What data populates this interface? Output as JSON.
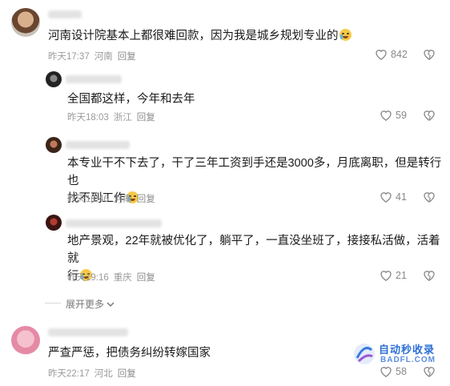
{
  "comments": [
    {
      "text": "河南设计院基本上都很难回款，因为我是城乡规划专业的",
      "time": "昨天17:37",
      "location": "河南",
      "reply": "回复",
      "likes": "842",
      "replies": [
        {
          "text": "全国都这样，今年和去年",
          "time": "昨天18:03",
          "location": "浙江",
          "reply": "回复",
          "likes": "59"
        },
        {
          "text_line1": "本专业干不下去了，干了三年工资到手还是3000多，月底离职，但是转行也",
          "text_line2": "找不到工作",
          "time": "昨天18:46",
          "location": "河南",
          "reply": "回复",
          "likes": "41"
        },
        {
          "text_line1": "地产景观，22年就被优化了，躺平了，一直没坐班了，接接私活做，活着就",
          "text_line2": "行",
          "time": "昨天19:16",
          "location": "重庆",
          "reply": "回复",
          "likes": "21"
        }
      ],
      "expand_label": "展开更多"
    },
    {
      "text": "严查严惩，把债务纠纷转嫁国家",
      "time": "昨天22:17",
      "location": "河北",
      "reply": "回复",
      "likes": "58"
    }
  ],
  "watermark": {
    "title": "自动秒收录",
    "url": "BADFL.COM"
  },
  "icons": {
    "like": "heart-outline-icon",
    "dislike": "broken-heart-icon",
    "expand": "chevron-down-icon",
    "emoji": "crying-face-emoji"
  },
  "colors": {
    "meta": "#9a9a9a",
    "watermark": "#2d6fd6",
    "background": "#ffffff"
  }
}
